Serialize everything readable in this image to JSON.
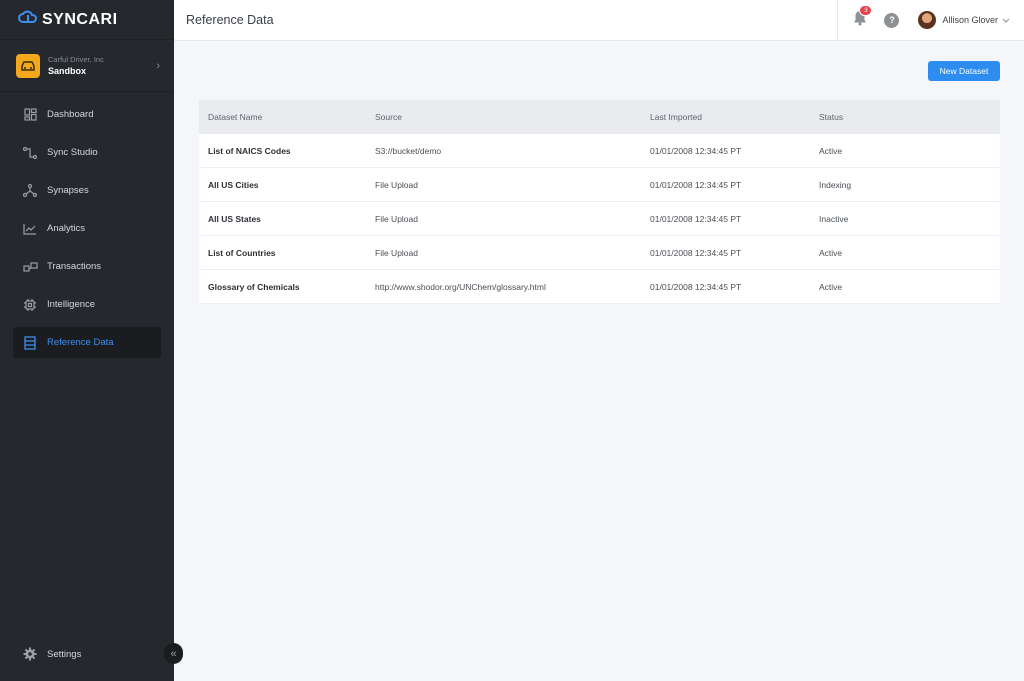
{
  "app": {
    "brand": "SYNCARI"
  },
  "org": {
    "company": "Carful Driver, Inc",
    "environment": "Sandbox"
  },
  "nav": {
    "items": [
      {
        "label": "Dashboard",
        "icon": "dashboard-icon"
      },
      {
        "label": "Sync Studio",
        "icon": "sync-studio-icon"
      },
      {
        "label": "Synapses",
        "icon": "synapses-icon"
      },
      {
        "label": "Analytics",
        "icon": "analytics-icon"
      },
      {
        "label": "Transactions",
        "icon": "transactions-icon"
      },
      {
        "label": "Intelligence",
        "icon": "intelligence-icon"
      },
      {
        "label": "Reference Data",
        "icon": "reference-data-icon",
        "active": true
      }
    ],
    "settings_label": "Settings",
    "collapse_glyph": "«"
  },
  "header": {
    "title": "Reference Data",
    "notification_count": "3",
    "help_glyph": "?",
    "user_name": "Allison Glover"
  },
  "actions": {
    "new_dataset_label": "New Dataset"
  },
  "table": {
    "columns": [
      "Dataset Name",
      "Source",
      "Last Imported",
      "Status"
    ],
    "rows": [
      {
        "name": "List of NAICS Codes",
        "source": "S3://bucket/demo",
        "imported": "01/01/2008 12:34:45 PT",
        "status": "Active"
      },
      {
        "name": "All US Cities",
        "source": "File Upload",
        "imported": "01/01/2008 12:34:45 PT",
        "status": "Indexing"
      },
      {
        "name": "All US States",
        "source": "File Upload",
        "imported": "01/01/2008 12:34:45 PT",
        "status": "Inactive"
      },
      {
        "name": "List of Countries",
        "source": "File Upload",
        "imported": "01/01/2008 12:34:45 PT",
        "status": "Active"
      },
      {
        "name": "Glossary of Chemicals",
        "source": "http://www.shodor.org/UNChem/glossary.html",
        "imported": "01/01/2008 12:34:45 PT",
        "status": "Active"
      }
    ]
  },
  "colors": {
    "accent": "#2d8cf0",
    "sidebar": "#25282c",
    "brand_icon": "#f4a91c",
    "badge": "#e8434b"
  }
}
